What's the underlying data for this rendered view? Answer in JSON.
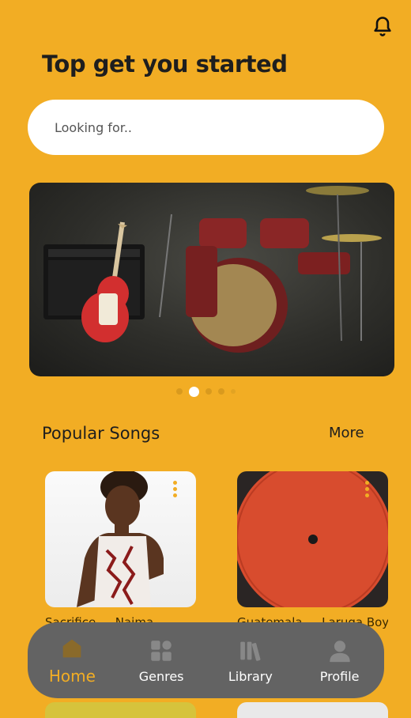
{
  "header": {
    "title": "Top get you started",
    "notification_icon": "bell-icon"
  },
  "search": {
    "placeholder": "Looking for.."
  },
  "banner": {
    "image": "guitar-and-drum-kit",
    "slides": 5,
    "active_slide": 2
  },
  "popular": {
    "title": "Popular Songs",
    "more_label": "More",
    "cards": [
      {
        "title": "Sacrifice — Naima",
        "image": "singer-portrait"
      },
      {
        "title": "Guatemala — Laruga Boys",
        "image": "laruga-boys-vinyl"
      }
    ]
  },
  "nav": {
    "items": [
      {
        "label": "Home",
        "icon": "home-icon",
        "active": true
      },
      {
        "label": "Genres",
        "icon": "grid-icon",
        "active": false
      },
      {
        "label": "Library",
        "icon": "library-icon",
        "active": false
      },
      {
        "label": "Profile",
        "icon": "profile-icon",
        "active": false
      }
    ]
  },
  "colors": {
    "background": "#f2ad24",
    "nav": "#636363",
    "accent": "#f2ad24"
  }
}
